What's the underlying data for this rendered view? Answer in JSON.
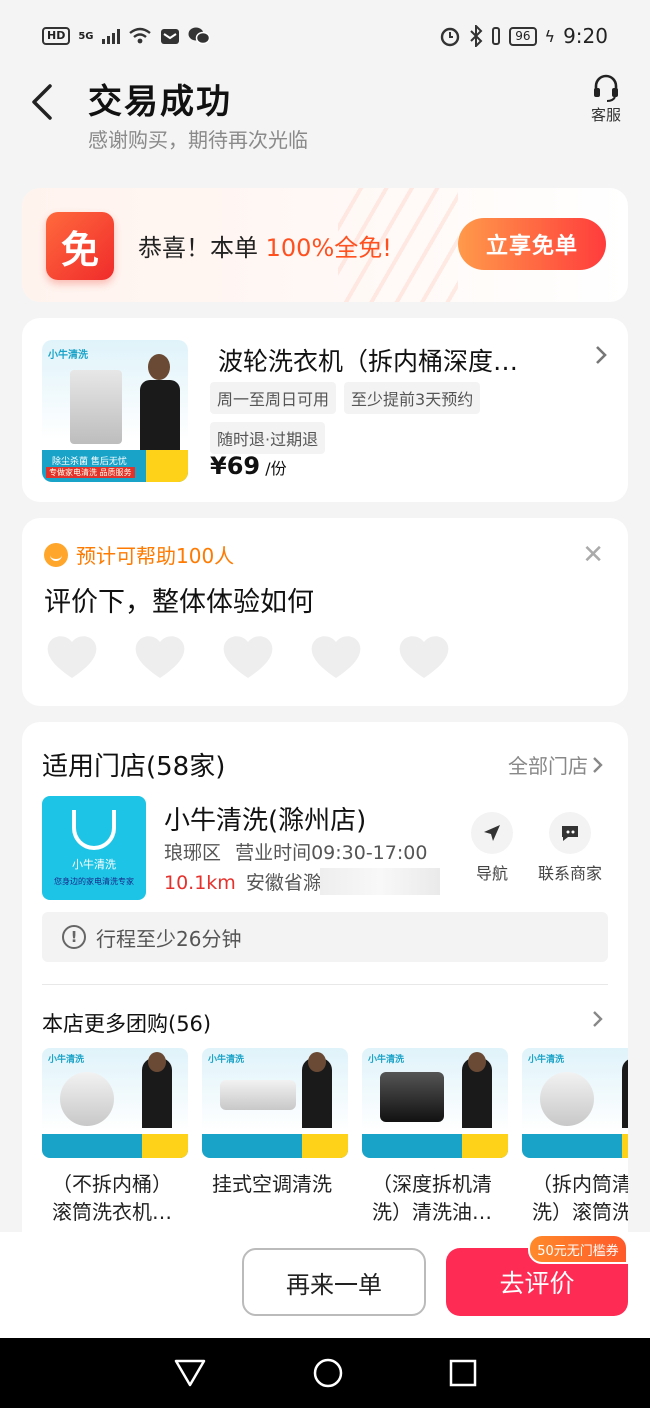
{
  "status_bar": {
    "hd": "HD",
    "network": "5G",
    "wifi_badge": "6",
    "battery": "96",
    "time": "9:20"
  },
  "header": {
    "title": "交易成功",
    "subtitle": "感谢购买，期待再次光临",
    "service_label": "客服"
  },
  "promo": {
    "icon_text": "免",
    "text_prefix": "恭喜！本单 ",
    "text_highlight": "100%全免!",
    "button_label": "立享免单"
  },
  "product": {
    "thumb_logo": "小牛清洗",
    "thumb_badge": "波轮洗衣机 全拆洗",
    "thumb_slogan": "除尘杀菌  售后无忧",
    "thumb_slogan2": "专做家电清洗  品质服务",
    "title": "波轮洗衣机（拆内桶深度…",
    "tags": [
      "周一至周日可用",
      "至少提前3天预约",
      "随时退·过期退"
    ],
    "price_symbol": "¥",
    "price": "69",
    "price_unit": "/份"
  },
  "review": {
    "help_text": "预计可帮助100人",
    "question": "评价下，整体体验如何",
    "close_icon": "close-icon",
    "hearts_count": 5
  },
  "stores": {
    "header": "适用门店(58家)",
    "all_link": "全部门店",
    "store": {
      "logo_name": "小牛清洗",
      "logo_slogan": "您身边的家电清洗专家",
      "name": "小牛清洗(滁州店)",
      "district": "琅琊区",
      "hours": "营业时间09:30-17:00",
      "distance": "10.1km",
      "address": "安徽省滁州市…"
    },
    "actions": {
      "navigate": "导航",
      "contact": "联系商家"
    },
    "trip": "行程至少26分钟",
    "more_header": "本店更多团购(56)",
    "deals": [
      {
        "line1": "（不拆内桶）",
        "line2": "滚筒洗衣机…"
      },
      {
        "line1": "挂式空调清洗",
        "line2": ""
      },
      {
        "line1": "（深度拆机清",
        "line2": "洗）清洗油…"
      },
      {
        "line1": "（拆内筒清",
        "line2": "洗）滚筒洗"
      }
    ]
  },
  "bottom": {
    "again_label": "再来一单",
    "review_label": "去评价",
    "coupon": "50元无门槛券"
  },
  "colors": {
    "accent": "#fe2c55",
    "promo_orange": "#ff5020",
    "help_orange": "#ff7a00",
    "distance_red": "#e5322d",
    "brand_cyan": "#1dc4e6"
  }
}
